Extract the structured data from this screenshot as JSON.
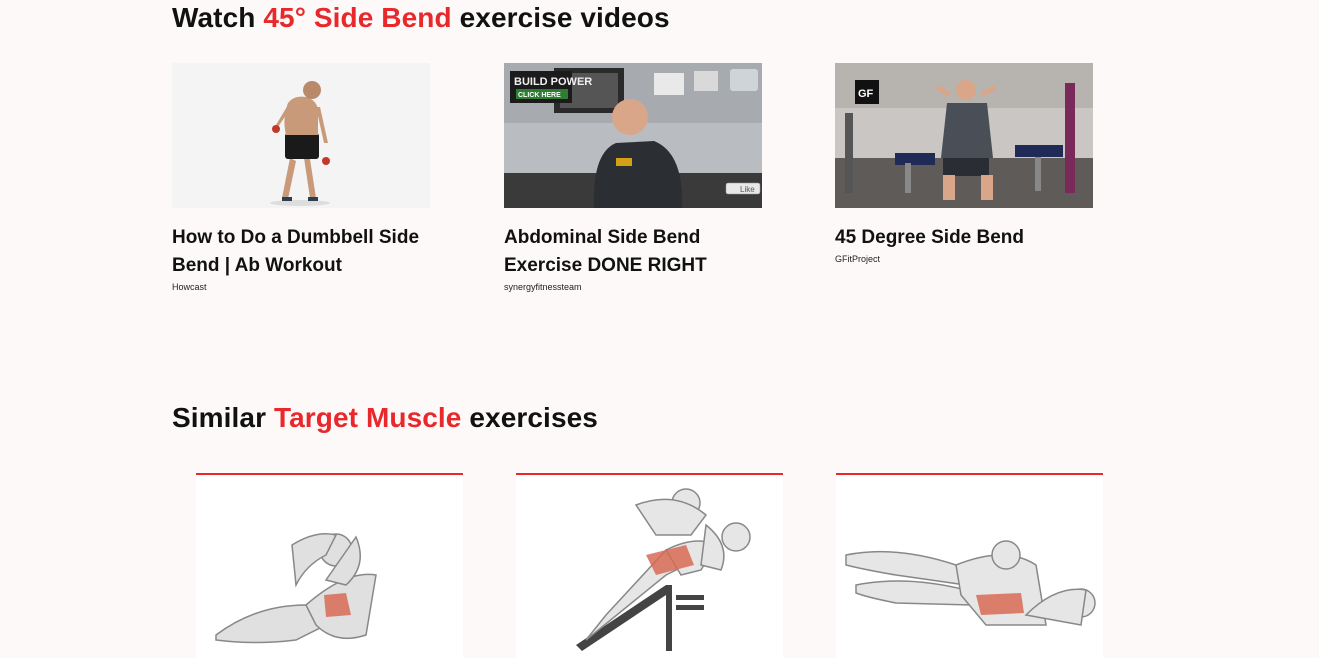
{
  "videos_section": {
    "title_pre": "Watch",
    "title_accent": "45° Side Bend",
    "title_post": "exercise videos",
    "videos": [
      {
        "title": "How to Do a Dumbbell Side Bend | Ab Workout",
        "channel": "Howcast"
      },
      {
        "title": "Abdominal Side Bend Exercise DONE RIGHT",
        "channel": "synergyfitnessteam",
        "overlay_text_1": "BUILD POWER",
        "overlay_text_2": "CLICK HERE",
        "like_label": "Like"
      },
      {
        "title": "45 Degree Side Bend",
        "channel": "GFitProject",
        "logo_text": "GF"
      }
    ]
  },
  "similar_section": {
    "title_pre": "Similar",
    "title_accent": "Target Muscle",
    "title_post": "exercises"
  },
  "colors": {
    "accent": "#e8282b",
    "background": "#fdf9f9"
  }
}
